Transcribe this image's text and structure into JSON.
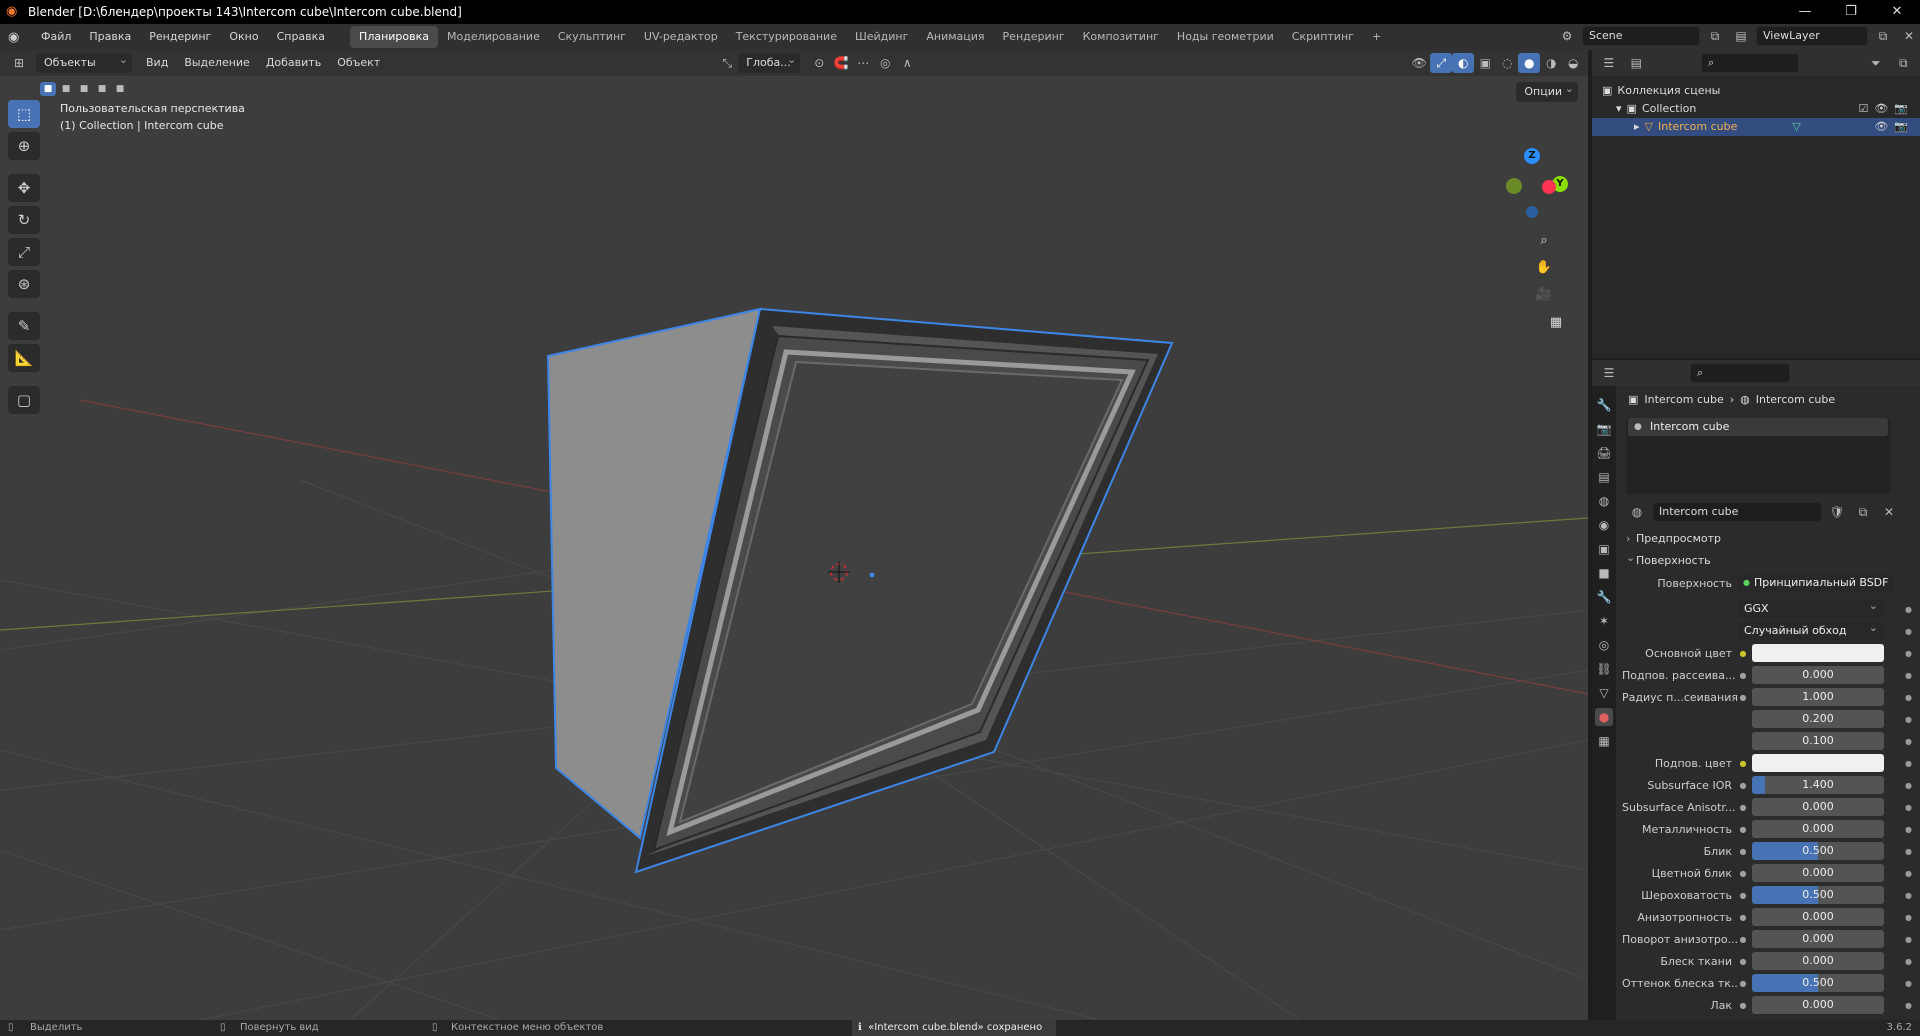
{
  "window": {
    "title": "Blender [D:\\блендер\\проекты 143\\Intercom cube\\Intercom cube.blend]",
    "controls": [
      "—",
      "❐",
      "✕"
    ]
  },
  "menu": {
    "items": [
      "Файл",
      "Правка",
      "Рендеринг",
      "Окно",
      "Справка"
    ],
    "workspaces": [
      "Планировка",
      "Моделирование",
      "Скульптинг",
      "UV-редактор",
      "Текстурирование",
      "Шейдинг",
      "Анимация",
      "Рендеринг",
      "Композитинг",
      "Ноды геометрии",
      "Скриптинг"
    ],
    "active_workspace": 0,
    "add_tab": "+",
    "scene": "Scene",
    "view_layer": "ViewLayer"
  },
  "viewport": {
    "mode": "Объекты",
    "header_items": [
      "Вид",
      "Выделение",
      "Добавить",
      "Объект"
    ],
    "orientation": "Глоба...",
    "options": "Опции",
    "info_line1": "Пользовательская перспектива",
    "info_line2": "(1) Collection | Intercom cube",
    "gizmo": {
      "z": "Z",
      "y": "Y"
    }
  },
  "outliner": {
    "rows": [
      {
        "label": "Коллекция сцены",
        "indent": 0
      },
      {
        "label": "Collection",
        "indent": 1
      },
      {
        "label": "Intercom cube",
        "indent": 2
      }
    ]
  },
  "properties": {
    "breadcrumb": [
      "Intercom cube",
      "Intercom cube"
    ],
    "slot": "Intercom cube",
    "material_name": "Intercom cube",
    "sections": {
      "preview": "Предпросмотр",
      "surface": "Поверхность"
    },
    "surface_label": "Поверхность",
    "surface_node": "Принципиальный BSDF",
    "distribution": "GGX",
    "subsurface_method": "Случайный обход",
    "rows": [
      {
        "label": "Основной цвет",
        "kind": "color"
      },
      {
        "label": "Подпов. рассеива...",
        "value": "0.000",
        "fill": 0
      },
      {
        "label": "Радиус п...сеивания",
        "value": "1.000",
        "fill": 0
      },
      {
        "label": "",
        "value": "0.200",
        "fill": 0
      },
      {
        "label": "",
        "value": "0.100",
        "fill": 0
      },
      {
        "label": "Подпов. цвет",
        "kind": "color"
      },
      {
        "label": "Subsurface IOR",
        "value": "1.400",
        "fill": 0.1
      },
      {
        "label": "Subsurface Anisotr...",
        "value": "0.000",
        "fill": 0
      },
      {
        "label": "Металличность",
        "value": "0.000",
        "fill": 0
      },
      {
        "label": "Блик",
        "value": "0.500",
        "fill": 0.5
      },
      {
        "label": "Цветной блик",
        "value": "0.000",
        "fill": 0
      },
      {
        "label": "Шероховатость",
        "value": "0.500",
        "fill": 0.5
      },
      {
        "label": "Анизотропность",
        "value": "0.000",
        "fill": 0
      },
      {
        "label": "Поворот анизотро...",
        "value": "0.000",
        "fill": 0
      },
      {
        "label": "Блеск ткани",
        "value": "0.000",
        "fill": 0
      },
      {
        "label": "Оттенок блеска тк...",
        "value": "0.500",
        "fill": 0.5
      },
      {
        "label": "Лак",
        "value": "0.000",
        "fill": 0
      }
    ]
  },
  "status": {
    "select": "Выделить",
    "rotate": "Повернуть вид",
    "context": "Контекстное меню объектов",
    "message": "«Intercom cube.blend» сохранено",
    "version": "3.6.2"
  },
  "colors": {
    "accent": "#4772b3",
    "selection_outline": "#3d86e6",
    "x_axis": "#ff3352",
    "y_axis": "#8bdc00",
    "z_axis": "#2890ff"
  }
}
